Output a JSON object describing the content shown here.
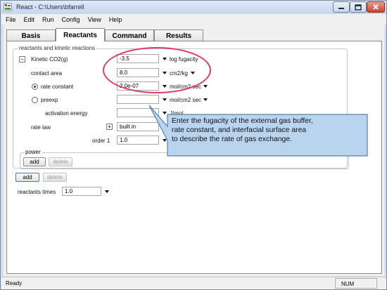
{
  "window": {
    "title": "React - C:\\Users\\bfarrell"
  },
  "menu": [
    "File",
    "Edit",
    "Run",
    "Config",
    "View",
    "Help"
  ],
  "tabs": [
    "Basis",
    "Reactants",
    "Command",
    "Results"
  ],
  "group": {
    "title": "reactants and kinetic reactions"
  },
  "reaction": {
    "expander": "−",
    "name": "Kinetic  CO2(g)",
    "fugacity": {
      "value": "-3.5",
      "unit": "log fugacity"
    },
    "contact_area": {
      "label": "contact area",
      "value": "8.0",
      "unit": "cm2/kg"
    },
    "rate_constant": {
      "label": "rate constant",
      "value": "2.0e-07",
      "unit": "mol/cm2 sec"
    },
    "preexp": {
      "label": "preexp",
      "value": "",
      "unit": "mol/cm2 sec"
    },
    "activation_energy": {
      "label": "activation energy",
      "value": "",
      "unit": "J/mol"
    },
    "rate_law": {
      "label": "rate law",
      "expander": "+",
      "value": "built in"
    },
    "order": {
      "label": "order 1",
      "value": "1.0"
    }
  },
  "power": {
    "title": "power",
    "add": "add",
    "delete": "delete"
  },
  "bottom_buttons": {
    "add": "add",
    "delete": "delete"
  },
  "reactants_times": {
    "label": "reactants times",
    "value": "1.0"
  },
  "status": {
    "text": "Ready",
    "num": "NUM"
  },
  "callout": {
    "lines": [
      "Enter the fugacity of the external gas buffer,",
      "rate constant, and interfacial surface area",
      "to describe the rate of gas exchange."
    ],
    "fill": "#b9d4ef",
    "stroke": "#5b7fb0",
    "ellipse_color": "#e23b6a"
  }
}
